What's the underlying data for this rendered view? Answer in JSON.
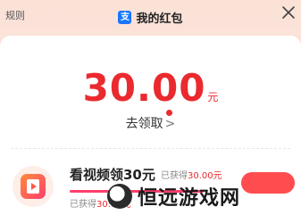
{
  "header": {
    "rules_label": "规则",
    "title": "我的红包",
    "app_icon": "alipay-icon",
    "close_icon": "close-icon"
  },
  "amount": {
    "value": "30.00",
    "unit": "元"
  },
  "collect": {
    "label": "去领取",
    "chevron": ">"
  },
  "task": {
    "icon": "video-play-icon",
    "title": "看视频领30元",
    "earned_prefix": "已获得",
    "earned_value": "30.00元",
    "earned_left_prefix": "已获得",
    "earned_left_value": "30.00元",
    "progress": 1.0
  },
  "watermark": {
    "text": "恒远游戏网"
  },
  "colors": {
    "accent": "#ea2a2f",
    "brand": "#1677ff"
  }
}
